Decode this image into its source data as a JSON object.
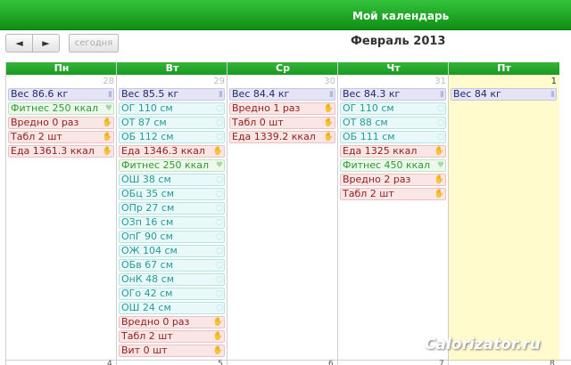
{
  "header": {
    "title": "Мой календарь"
  },
  "toolbar": {
    "prev": "◄",
    "next": "►",
    "today": "сегодня"
  },
  "month": "Февраль 2013",
  "days": [
    "Пн",
    "Вт",
    "Ср",
    "Чт",
    "Пт"
  ],
  "day_numbers": [
    "28",
    "29",
    "30",
    "31",
    "1"
  ],
  "bottom_numbers": [
    "4",
    "5",
    "6",
    "7",
    "8"
  ],
  "columns": [
    [
      {
        "t": "Вес 86.6 кг",
        "c": "blue"
      },
      {
        "t": "Фитнес 250 ккал",
        "c": "green"
      },
      {
        "t": "Вредно 0 раз",
        "c": "red"
      },
      {
        "t": "Табл 2 шт",
        "c": "red"
      },
      {
        "t": "Еда 1361.3 ккал",
        "c": "red"
      }
    ],
    [
      {
        "t": "Вес 85.5 кг",
        "c": "blue"
      },
      {
        "t": "ОГ 110 см",
        "c": "cyan"
      },
      {
        "t": "ОТ 87 см",
        "c": "cyan"
      },
      {
        "t": "ОБ 112 см",
        "c": "cyan"
      },
      {
        "t": "Еда 1346.3 ккал",
        "c": "red"
      },
      {
        "t": "Фитнес 250 ккал",
        "c": "green"
      },
      {
        "t": "ОШ 38 см",
        "c": "cyan"
      },
      {
        "t": "ОБц 35 см",
        "c": "cyan"
      },
      {
        "t": "ОПр 27 см",
        "c": "cyan"
      },
      {
        "t": "ОЗп 16 см",
        "c": "cyan"
      },
      {
        "t": "ОпГ 90 см",
        "c": "cyan"
      },
      {
        "t": "ОЖ 104 см",
        "c": "cyan"
      },
      {
        "t": "ОБв 67 см",
        "c": "cyan"
      },
      {
        "t": "ОнК 48 см",
        "c": "cyan"
      },
      {
        "t": "ОГо 42 см",
        "c": "cyan"
      },
      {
        "t": "ОШ 24 см",
        "c": "cyan"
      },
      {
        "t": "Вредно 0 раз",
        "c": "red"
      },
      {
        "t": "Табл 2 шт",
        "c": "red"
      },
      {
        "t": "Вит 0 шт",
        "c": "red"
      }
    ],
    [
      {
        "t": "Вес 84.4 кг",
        "c": "blue"
      },
      {
        "t": "Вредно 1 раз",
        "c": "red"
      },
      {
        "t": "Табл 0 шт",
        "c": "red"
      },
      {
        "t": "Еда 1339.2 ккал",
        "c": "red"
      }
    ],
    [
      {
        "t": "Вес 84.3 кг",
        "c": "blue"
      },
      {
        "t": "ОГ 110 см",
        "c": "cyan"
      },
      {
        "t": "ОТ 88 см",
        "c": "cyan"
      },
      {
        "t": "ОБ 111 см",
        "c": "cyan"
      },
      {
        "t": "Еда 1325 ккал",
        "c": "red"
      },
      {
        "t": "Фитнес 450 ккал",
        "c": "green"
      },
      {
        "t": "Вредно 2 раз",
        "c": "red"
      },
      {
        "t": "Табл 2 шт",
        "c": "red"
      }
    ],
    [
      {
        "t": "Вес 84 кг",
        "c": "blue"
      }
    ]
  ],
  "icons": {
    "blue": "doc-icon",
    "cyan": "refresh-icon",
    "green": "heart-icon",
    "red": "hand-icon"
  },
  "watermark": "Calorizator.ru"
}
